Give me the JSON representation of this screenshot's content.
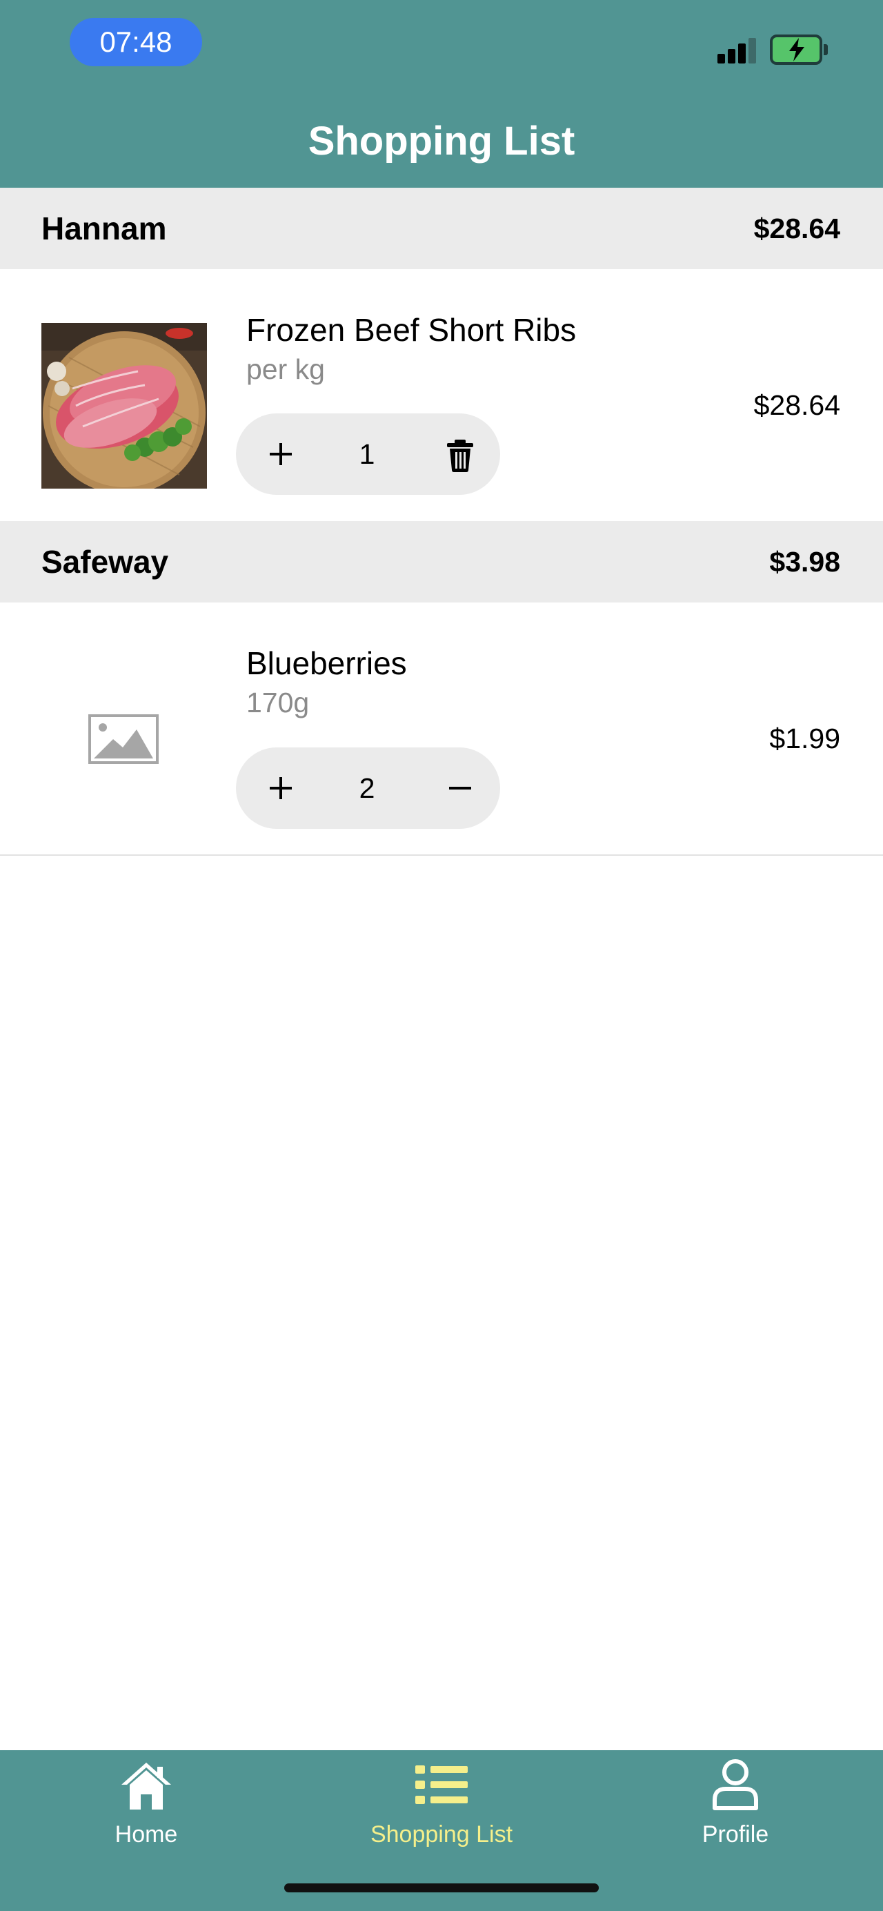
{
  "status_bar": {
    "time": "07:48"
  },
  "header": {
    "title": "Shopping List"
  },
  "colors": {
    "brand": "#519593",
    "accent_active": "#f5ef8b",
    "time_pill": "#3a7af0",
    "section_bg": "#ebebeb"
  },
  "stores": [
    {
      "name": "Hannam",
      "total": "$28.64",
      "items": [
        {
          "name": "Frozen Beef Short Ribs",
          "unit": "per kg",
          "quantity": "1",
          "price": "$28.64",
          "right_control": "trash-icon"
        }
      ]
    },
    {
      "name": "Safeway",
      "total": "$3.98",
      "items": [
        {
          "name": "Blueberries",
          "unit": "170g",
          "quantity": "2",
          "price": "$1.99",
          "right_control": "minus-icon"
        }
      ]
    }
  ],
  "tabbar": {
    "tabs": [
      {
        "label": "Home",
        "icon": "home-icon",
        "active": false
      },
      {
        "label": "Shopping List",
        "icon": "list-icon",
        "active": true
      },
      {
        "label": "Profile",
        "icon": "person-icon",
        "active": false
      }
    ]
  }
}
